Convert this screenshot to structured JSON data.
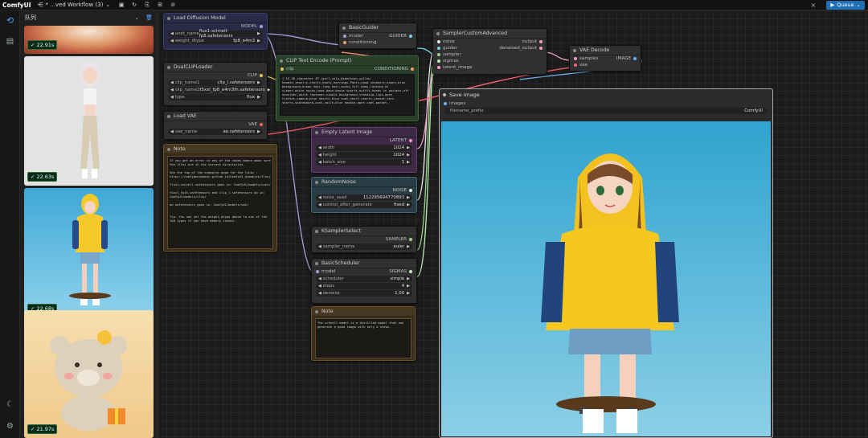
{
  "topbar": {
    "brand": "ComfyUI",
    "workflow_name": "* ...ved Workflow (3)",
    "queue_label": "Queue",
    "close_label": "×"
  },
  "queue_panel": {
    "title": "队列",
    "items": [
      {
        "time": "22.91s"
      },
      {
        "time": "22.63s"
      },
      {
        "time": "22.68s"
      },
      {
        "time": "21.97s"
      }
    ]
  },
  "nodes": {
    "load_diffusion": {
      "title": "Load Diffusion Model",
      "output": "MODEL",
      "unet_name_label": "unet_name",
      "unet_name_value": "flux1-schnell-fp8.safetensors",
      "weight_dtype_label": "weight_dtype",
      "weight_dtype_value": "fp8_e4m3"
    },
    "dual_clip": {
      "title": "DualCLIPLoader",
      "output": "CLIP",
      "clip_name1_label": "clip_name1",
      "clip_name1_value": "clip_l.safetensors",
      "clip_name2_label": "clip_name2",
      "clip_name2_value": "t5xxl_fp8_e4m3fn.safetensors",
      "type_label": "type",
      "type_value": "flux"
    },
    "load_vae": {
      "title": "Load VAE",
      "output": "VAE",
      "vae_name_label": "vae_name",
      "vae_name_value": "ae.safetensors"
    },
    "note1": {
      "title": "Note",
      "text": "If you get an error in any of the nodes above make sure the files are in the correct directories.\n\nSee the top of the examples page for the links : https://comfyanonymous.github.io/ComfyUI_examples/flux/\n\nflux1-schnell.safetensors goes in: ComfyUI/models/unet/\n\nt5xxl_fp16.safetensors and clip_l.safetensors go in: ComfyUI/models/clip/\n\nae.safetensors goes in: ComfyUI/models/vae/\n\n\nTip: You can set the weight_dtype above to one of the fp8 types if you have memory issues."
    },
    "clip_text": {
      "title": "CLIP Text Encode (Prompt)",
      "input": "clip",
      "output": "CONDITIONING",
      "text": "('IX_3D character IP (girl,solo,dimension,yellow hoodie,jewelry,shorts,boots,earrings,Pants,hood sneakers,shoes,blue background,brown hair,long hair,socks,full body,looking at viewer,white socks,hood down,denim shorts,outfit,hands in pockets,off shoulder,white footwear,simple background,standing,lips,open clothes,camera,blue shorts,blue coat,short shorts,jacket,torn shorts,skateboard,coat,smile,blue hoodie,open coat,pocket,"
    },
    "basic_guider": {
      "title": "BasicGuider",
      "input_model": "model",
      "input_cond": "conditioning",
      "output": "GUIDER"
    },
    "sampler_adv": {
      "title": "SamplerCustomAdvanced",
      "inputs": [
        "noise",
        "guider",
        "sampler",
        "sigmas",
        "latent_image"
      ],
      "outputs": [
        "output",
        "denoised_output"
      ]
    },
    "vae_decode": {
      "title": "VAE Decode",
      "inputs": [
        "samples",
        "vae"
      ],
      "output": "IMAGE"
    },
    "empty_latent": {
      "title": "Empty Latent Image",
      "output": "LATENT",
      "width_label": "width",
      "width_value": "1024",
      "height_label": "height",
      "height_value": "1024",
      "batch_label": "batch_size",
      "batch_value": "1"
    },
    "random_noise": {
      "title": "RandomNoise",
      "output": "NOISE",
      "seed_label": "noise_seed",
      "seed_value": "112295694770893",
      "cag_label": "control_after_generate",
      "cag_value": "fixed"
    },
    "ksampler_select": {
      "title": "KSamplerSelect",
      "output": "SAMPLER",
      "sampler_label": "sampler_name",
      "sampler_value": "euler"
    },
    "basic_scheduler": {
      "title": "BasicScheduler",
      "input": "model",
      "output": "SIGMAS",
      "scheduler_label": "scheduler",
      "scheduler_value": "simple",
      "steps_label": "steps",
      "steps_value": "4",
      "denoise_label": "denoise",
      "denoise_value": "1.00"
    },
    "note2": {
      "title": "Note",
      "text": "The schnell model is a distilled model that can generate a good image with only 4 steps."
    },
    "save_image": {
      "title": "Save Image",
      "input": "images",
      "prefix_label": "filename_prefix",
      "prefix_value": "ComfyUI"
    }
  },
  "colors": {
    "accent": "#1f6fb5",
    "model_node": "#2a2a48",
    "clip_node": "#2a3f2a",
    "latent_node": "#3e2a44",
    "noise_node": "#2a3c44",
    "note_node": "#3a2f1f",
    "badge": "#0c2a18"
  }
}
